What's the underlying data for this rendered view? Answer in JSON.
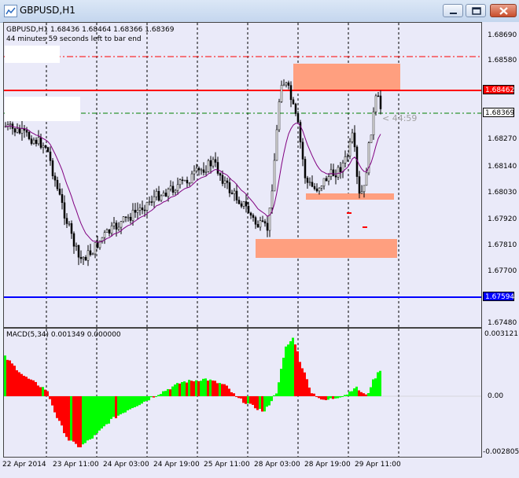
{
  "window": {
    "title": "GBPUSD,H1",
    "header_line": "GBPUSD,H1  1.68436 1.68464 1.68366 1.68369",
    "countdown": "44 minutes 59 seconds left to bar end",
    "bar_timer": "< 44:59"
  },
  "price_axis": {
    "ticks": [
      "1.68690",
      "1.68580",
      "1.68370",
      "1.68270",
      "1.68140",
      "1.68030",
      "1.67920",
      "1.67810",
      "1.67700",
      "1.67480"
    ],
    "tags": [
      {
        "value": "1.68462",
        "color": "#ff0000"
      },
      {
        "value": "1.68369",
        "color": "#000000"
      },
      {
        "value": "1.67594",
        "color": "#0000ff"
      }
    ]
  },
  "macd": {
    "label": "MACD(5,34) 0.001349 0.000000",
    "ticks": [
      "0.003121",
      "0.00",
      "-0.002805"
    ]
  },
  "time_axis": [
    "22 Apr 2014",
    "23 Apr 11:00",
    "24 Apr 03:00",
    "24 Apr 19:00",
    "25 Apr 11:00",
    "28 Apr 03:00",
    "28 Apr 19:00",
    "29 Apr 11:00"
  ],
  "levels": {
    "resistance": "1.68462",
    "current": "1.68369",
    "support": "1.67594"
  },
  "colors": {
    "bull": "#00ff00",
    "bear": "#ff0000",
    "ma": "#800080",
    "zone": "#ff9f7f"
  }
}
